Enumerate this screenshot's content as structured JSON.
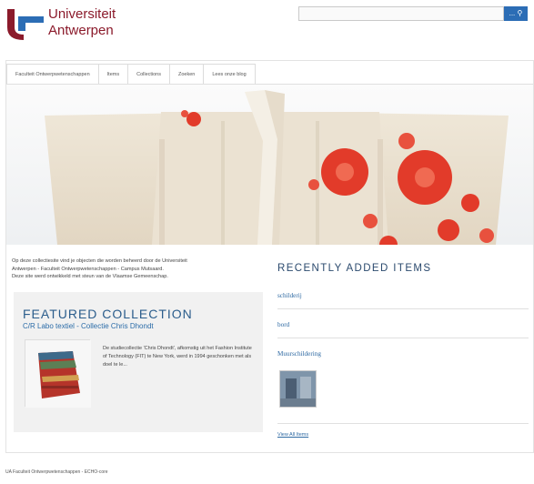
{
  "header": {
    "logo_line1": "Universiteit",
    "logo_line2": "Antwerpen",
    "brand_color": "#8b1a2b",
    "accent_color": "#2c6db5"
  },
  "search": {
    "placeholder": "",
    "button_label": "...",
    "button_icon": "search-icon"
  },
  "nav": {
    "items": [
      {
        "label": "Faculteit Ontwerpwetenschappen"
      },
      {
        "label": "Items"
      },
      {
        "label": "Collections"
      },
      {
        "label": "Zoeken"
      },
      {
        "label": "Lees onze blog"
      }
    ]
  },
  "intro": {
    "line1": "Op deze collectiesite vind je objecten die worden beheerd door de Universiteit",
    "line2": "Antwerpen - Faculteit Ontwerpwetenschappen - Campus Mutsaard.",
    "line3": "Deze site werd ontwikkeld met steun van de Vlaamse Gemeenschap."
  },
  "featured": {
    "heading": "FEATURED COLLECTION",
    "collection_name": "C/R Labo textiel - Collectie Chris Dhondt",
    "description": "De studiecollectie 'Chris Dhondt', afkomstig uit het Fashion Institute of Technology (FIT) te New York, werd in 1994 geschonken met als doel te le..."
  },
  "recent": {
    "heading": "RECENTLY ADDED ITEMS",
    "items": [
      {
        "title": "schilderij"
      },
      {
        "title": "bord"
      },
      {
        "title": "Muurschildering"
      }
    ],
    "view_all": "View All Items"
  },
  "footer": {
    "text": "UA Faculteit Ontwerpwetenschappen - ECHO-core"
  }
}
